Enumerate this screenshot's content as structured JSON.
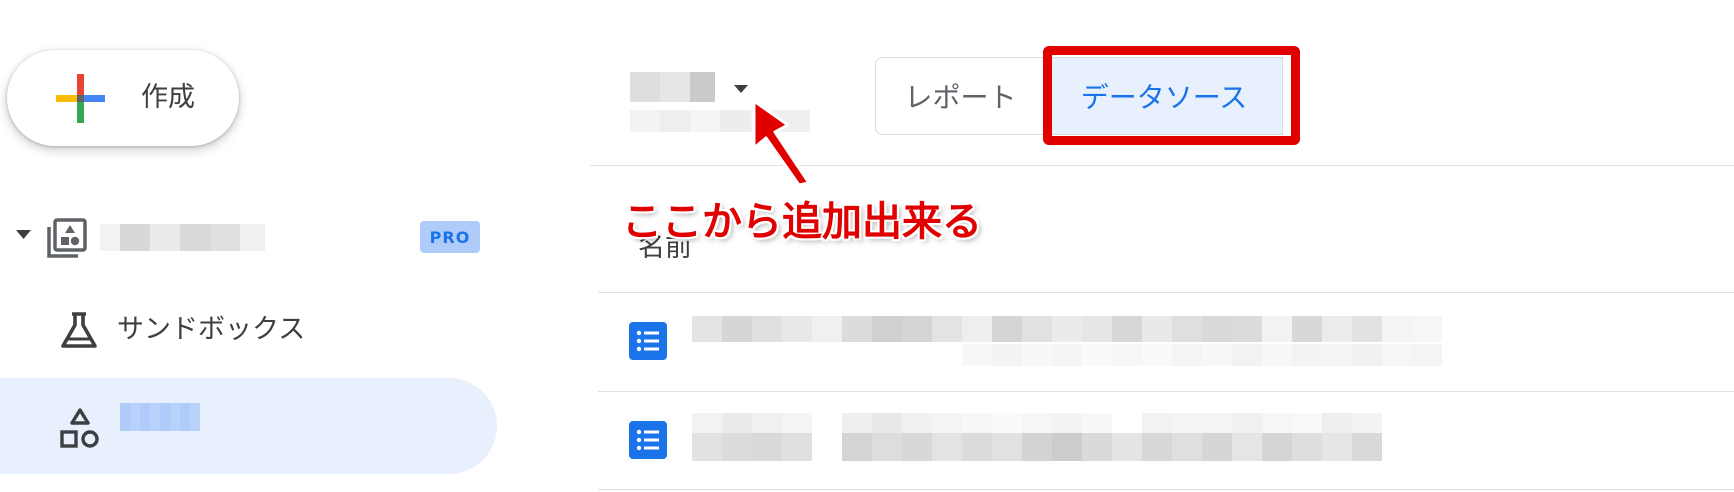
{
  "sidebar": {
    "create_label": "作成",
    "workspace": {
      "badge": "PRO"
    },
    "items": [
      {
        "label": "サンドボックス",
        "icon": "flask-icon"
      },
      {
        "label": "",
        "icon": "shapes-icon"
      }
    ]
  },
  "header": {
    "tabs": [
      {
        "label": "レポート",
        "selected": false
      },
      {
        "label": "データソース",
        "selected": true
      }
    ]
  },
  "table": {
    "column_name": "名前",
    "rows": [
      {
        "icon": "datasource-list-icon"
      },
      {
        "icon": "datasource-list-icon"
      }
    ]
  },
  "annotation": {
    "text": "ここから追加出来る",
    "color": "#e00000"
  },
  "colors": {
    "accent": "#1a73e8",
    "selected_bg": "#e8f0fe",
    "badge_bg": "#aecbfa",
    "annotation_red": "#e00000"
  }
}
